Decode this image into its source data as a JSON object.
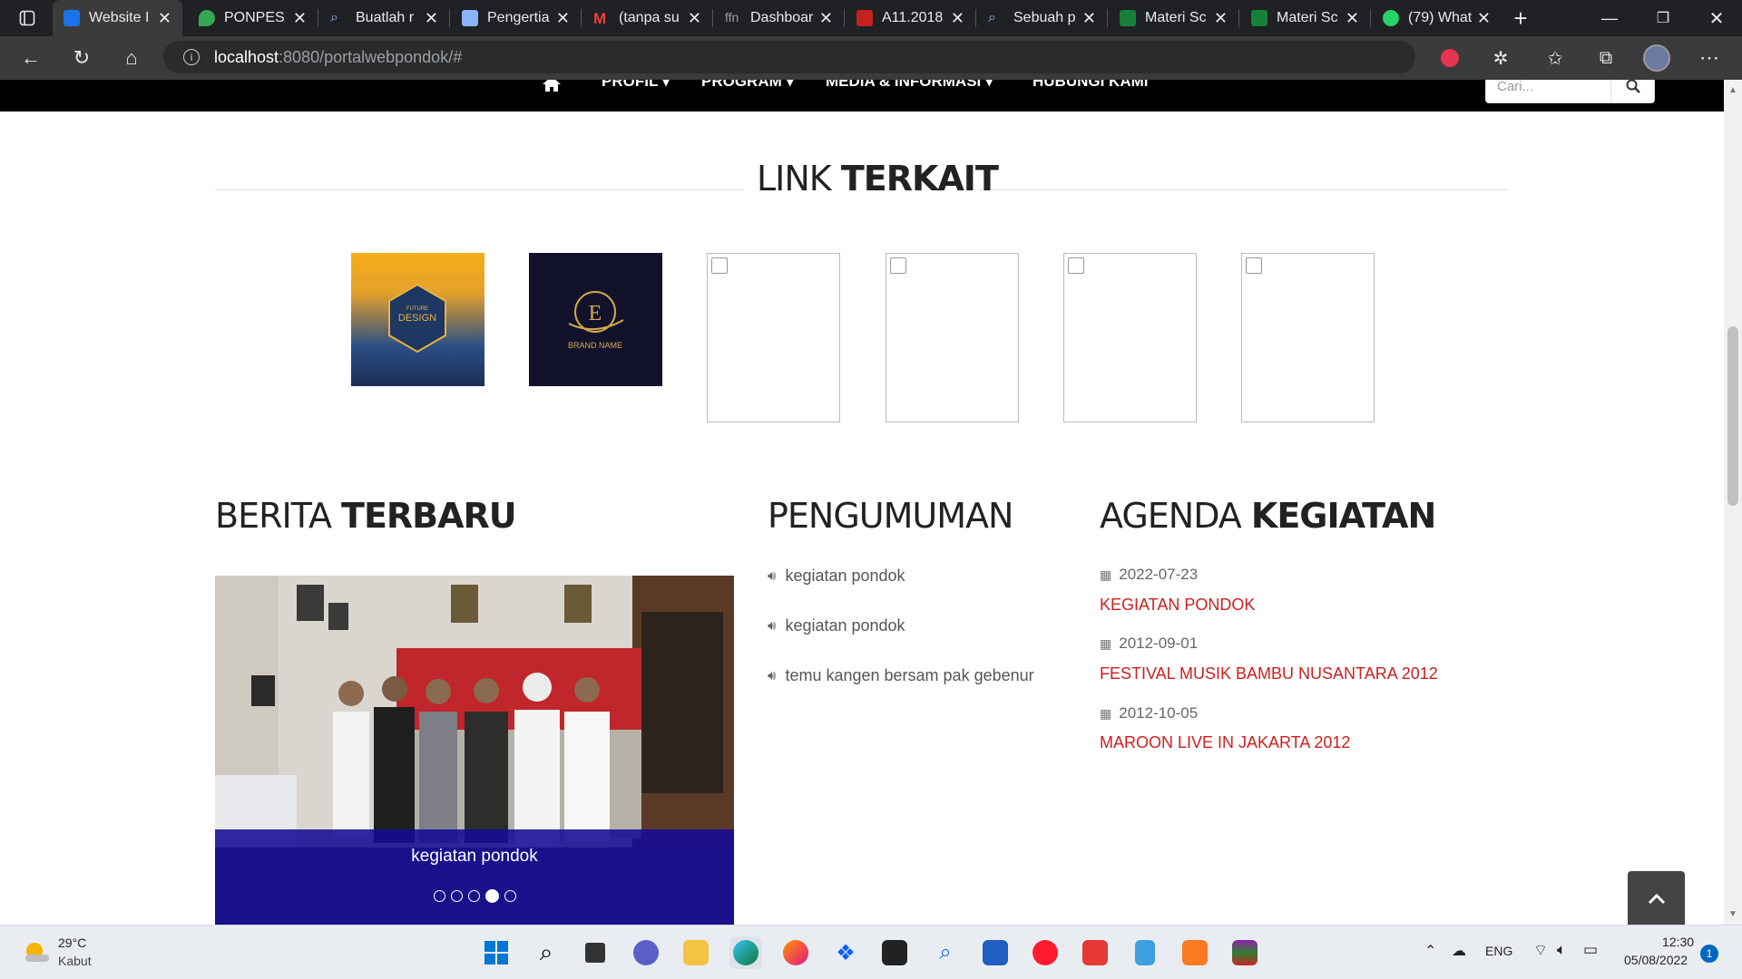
{
  "browser": {
    "tabs": [
      {
        "title": "Website I",
        "active": true,
        "color": "#1a73e8"
      },
      {
        "title": "PONPES I",
        "active": false,
        "color": "#34a853"
      },
      {
        "title": "Buatlah r",
        "active": false,
        "color": "#5f6368"
      },
      {
        "title": "Pengertia",
        "active": false,
        "color": "#8ab4f8"
      },
      {
        "title": "(tanpa su",
        "active": false,
        "color": "#ea4335"
      },
      {
        "title": "Dashboar",
        "active": false,
        "color": "#9aa0a6"
      },
      {
        "title": "A11.2018",
        "active": false,
        "color": "#c5221f"
      },
      {
        "title": "Sebuah p",
        "active": false,
        "color": "#5f6368"
      },
      {
        "title": "Materi Sc",
        "active": false,
        "color": "#188038"
      },
      {
        "title": "Materi Sc",
        "active": false,
        "color": "#188038"
      },
      {
        "title": "(79) What",
        "active": false,
        "color": "#25d366"
      }
    ],
    "url_host": "localhost",
    "url_path": ":8080/portalwebpondok/#"
  },
  "nav": {
    "home_icon": "home-icon",
    "items": [
      "PROFIL ▾",
      "PROGRAM ▾",
      "MEDIA & INFORMASI ▾",
      "HUBUNGI KAMI"
    ],
    "search_placeholder": "Cari..."
  },
  "link_terkait": {
    "title_light": "LINK ",
    "title_bold": "TERKAIT",
    "logos": [
      {
        "text": "DESIGN",
        "sub": "FUTURE"
      },
      {
        "text": "E",
        "sub": "BRAND NAME"
      }
    ]
  },
  "berita": {
    "title_light": "BERITA ",
    "title_bold": "TERBARU",
    "caption": "kegiatan pondok",
    "slides": 5,
    "active_slide": 4
  },
  "pengumuman": {
    "title": "PENGUMUMAN",
    "items": [
      "kegiatan pondok",
      "kegiatan pondok",
      "temu kangen bersam pak gebenur"
    ]
  },
  "agenda": {
    "title_light": "AGENDA ",
    "title_bold": "KEGIATAN",
    "items": [
      {
        "date": "2022-07-23",
        "title": "KEGIATAN PONDOK"
      },
      {
        "date": "2012-09-01",
        "title": "FESTIVAL MUSIK BAMBU NUSANTARA 2012"
      },
      {
        "date": "2012-10-05",
        "title": "MAROON LIVE IN JAKARTA 2012"
      }
    ]
  },
  "taskbar": {
    "weather_temp": "29°C",
    "weather_desc": "Kabut",
    "lang": "ENG",
    "time": "12:30",
    "date": "05/08/2022",
    "notif_count": "1",
    "apps": [
      "windows-start",
      "search",
      "task-view",
      "teams-chat",
      "file-explorer",
      "edge",
      "firefox",
      "dropbox",
      "notion",
      "search-app",
      "store",
      "opera",
      "wps-office",
      "notepad",
      "xampp",
      "winrar"
    ]
  }
}
